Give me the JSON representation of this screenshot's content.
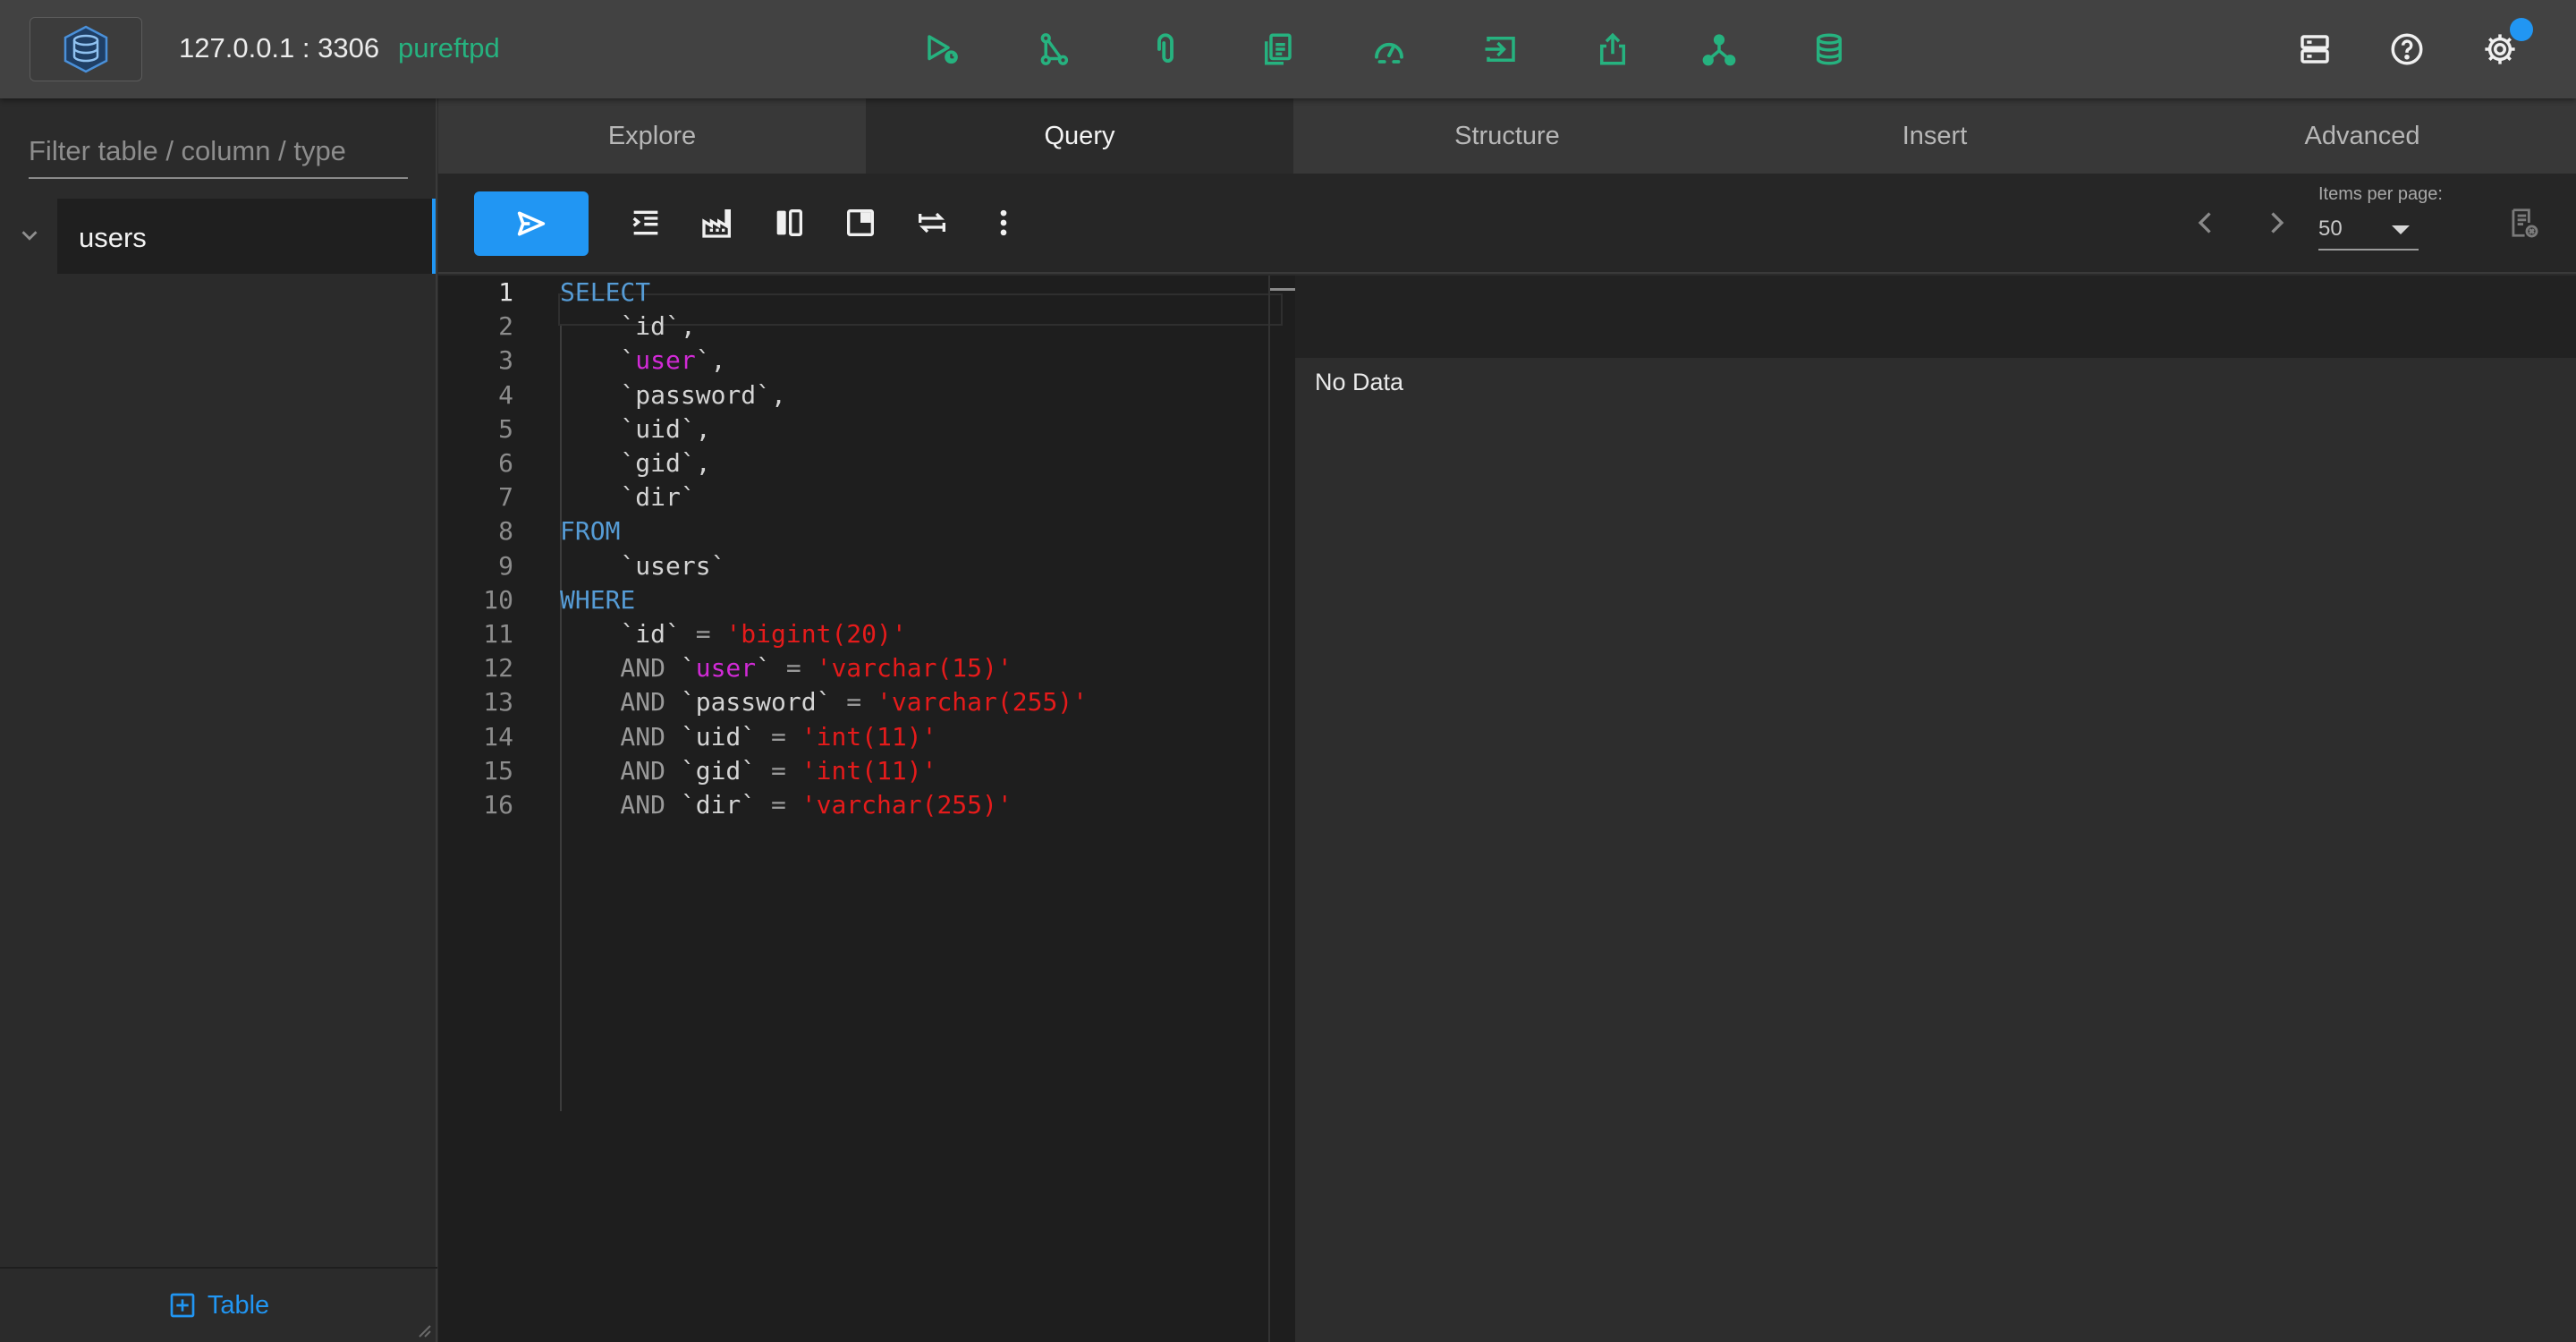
{
  "header": {
    "host": "127.0.0.1 : 3306",
    "database": "pureftpd",
    "tool_icons": [
      "run-timer-icon",
      "share-nodes-icon",
      "attachment-icon",
      "copy-file-icon",
      "dashboard-gauge-icon",
      "input-icon",
      "upload-icon",
      "hierarchy-icon",
      "database-icon"
    ],
    "right_icons": [
      "server-icon",
      "help-icon",
      "settings-icon"
    ],
    "accent_color": "#26b27f",
    "notification_color": "#2196f3"
  },
  "sidebar": {
    "filter_placeholder": "Filter table / column / type",
    "items": [
      {
        "label": "users"
      }
    ],
    "add_table_label": "Table"
  },
  "tabs": [
    {
      "label": "Explore"
    },
    {
      "label": "Query",
      "active": true
    },
    {
      "label": "Structure"
    },
    {
      "label": "Insert"
    },
    {
      "label": "Advanced"
    }
  ],
  "toolbar": {
    "run_icon": "send-icon",
    "editor_icons": [
      "format-indent-icon",
      "factory-icon",
      "split-view-icon",
      "panel-icon",
      "swap-icon",
      "more-vert-icon"
    ],
    "items_per_page_label": "Items per page:",
    "items_per_page_value": "50"
  },
  "editor": {
    "lines": [
      {
        "num": "1",
        "tokens": [
          [
            "kw",
            "SELECT"
          ]
        ]
      },
      {
        "num": "2",
        "tokens": [
          [
            "def",
            "    `id`,"
          ]
        ]
      },
      {
        "num": "3",
        "tokens": [
          [
            "def",
            "    `"
          ],
          [
            "mag",
            "user"
          ],
          [
            "def",
            "`,"
          ]
        ]
      },
      {
        "num": "4",
        "tokens": [
          [
            "def",
            "    `password`,"
          ]
        ]
      },
      {
        "num": "5",
        "tokens": [
          [
            "def",
            "    `uid`,"
          ]
        ]
      },
      {
        "num": "6",
        "tokens": [
          [
            "def",
            "    `gid`,"
          ]
        ]
      },
      {
        "num": "7",
        "tokens": [
          [
            "def",
            "    `dir`"
          ]
        ]
      },
      {
        "num": "8",
        "tokens": [
          [
            "kw",
            "FROM"
          ]
        ]
      },
      {
        "num": "9",
        "tokens": [
          [
            "def",
            "    `users`"
          ]
        ]
      },
      {
        "num": "10",
        "tokens": [
          [
            "kw",
            "WHERE"
          ]
        ]
      },
      {
        "num": "11",
        "tokens": [
          [
            "def",
            "    `id` "
          ],
          [
            "op",
            "="
          ],
          [
            "def",
            " "
          ],
          [
            "str",
            "'bigint(20)'"
          ]
        ]
      },
      {
        "num": "12",
        "tokens": [
          [
            "op",
            "    AND "
          ],
          [
            "def",
            "`"
          ],
          [
            "mag",
            "user"
          ],
          [
            "def",
            "` "
          ],
          [
            "op",
            "="
          ],
          [
            "def",
            " "
          ],
          [
            "str",
            "'varchar(15)'"
          ]
        ]
      },
      {
        "num": "13",
        "tokens": [
          [
            "op",
            "    AND "
          ],
          [
            "def",
            "`password` "
          ],
          [
            "op",
            "="
          ],
          [
            "def",
            " "
          ],
          [
            "str",
            "'varchar(255)'"
          ]
        ]
      },
      {
        "num": "14",
        "tokens": [
          [
            "op",
            "    AND "
          ],
          [
            "def",
            "`uid` "
          ],
          [
            "op",
            "="
          ],
          [
            "def",
            " "
          ],
          [
            "str",
            "'int(11)'"
          ]
        ]
      },
      {
        "num": "15",
        "tokens": [
          [
            "op",
            "    AND "
          ],
          [
            "def",
            "`gid` "
          ],
          [
            "op",
            "="
          ],
          [
            "def",
            " "
          ],
          [
            "str",
            "'int(11)'"
          ]
        ]
      },
      {
        "num": "16",
        "tokens": [
          [
            "op",
            "    AND "
          ],
          [
            "def",
            "`dir` "
          ],
          [
            "op",
            "="
          ],
          [
            "def",
            " "
          ],
          [
            "str",
            "'varchar(255)'"
          ]
        ]
      }
    ]
  },
  "results": {
    "empty_text": "No Data"
  }
}
